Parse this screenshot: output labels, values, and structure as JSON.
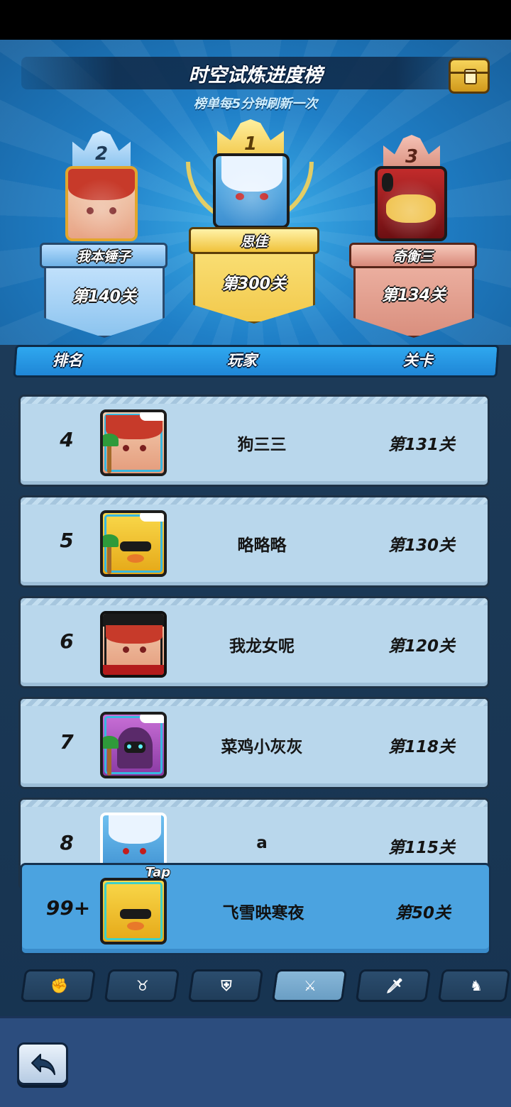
{
  "header": {
    "title": "时空试炼进度榜",
    "subtitle": "榜单每5分钟刷新一次"
  },
  "podium": [
    {
      "rank": "2",
      "name": "我本锤子",
      "stage": "第140关"
    },
    {
      "rank": "1",
      "name": "思佳",
      "stage": "第300关"
    },
    {
      "rank": "3",
      "name": "奇衡三",
      "stage": "第134关"
    }
  ],
  "columns": {
    "rank": "排名",
    "player": "玩家",
    "stage": "关卡"
  },
  "rows": [
    {
      "rank": "4",
      "name": "狗三三",
      "stage": "第131关"
    },
    {
      "rank": "5",
      "name": "略略略",
      "stage": "第130关"
    },
    {
      "rank": "6",
      "name": "我龙女呢",
      "stage": "第120关"
    },
    {
      "rank": "7",
      "name": "菜鸡小灰灰",
      "stage": "第118关"
    },
    {
      "rank": "8",
      "name": "a",
      "stage": "第115关"
    }
  ],
  "me": {
    "rank": "99+",
    "name": "飞雪映寒夜",
    "stage": "第50关",
    "tap_label": "Tap"
  },
  "tabs": [
    {
      "icon": "fist-icon"
    },
    {
      "icon": "bull-icon"
    },
    {
      "icon": "shield-icon"
    },
    {
      "icon": "swords-icon",
      "active": true
    },
    {
      "icon": "sword-icon"
    },
    {
      "icon": "helmet-icon"
    }
  ],
  "colors": {
    "gold": "#f2c94c",
    "silver": "#8cc4ef",
    "bronze": "#d98f7e",
    "row_bg": "#b9d7ec",
    "me_bg": "#4ba3e0"
  }
}
